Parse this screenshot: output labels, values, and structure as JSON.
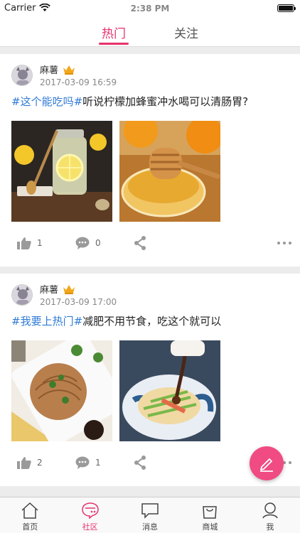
{
  "status_bar": {
    "carrier": "Carrier",
    "time": "2:38 PM"
  },
  "tabs": [
    {
      "label": "热门",
      "active": true
    },
    {
      "label": "关注",
      "active": false
    }
  ],
  "posts": [
    {
      "user": "麻薯",
      "time": "2017-03-09 16:59",
      "tag": "#这个能吃吗#",
      "text": "听说柠檬加蜂蜜冲水喝可以清肠胃?",
      "likes": "1",
      "comments": "0",
      "photos": [
        "lemon-honey-jar",
        "honey-dipper-bowl"
      ]
    },
    {
      "user": "麻薯",
      "time": "2017-03-09 17:00",
      "tag": "#我要上热门#",
      "text": "减肥不用节食，吃这个就可以",
      "likes": "2",
      "comments": "1",
      "photos": [
        "pasta-plate",
        "noodle-salad"
      ]
    }
  ],
  "bottom_nav": [
    {
      "label": "首页",
      "icon": "home-icon",
      "active": false
    },
    {
      "label": "社区",
      "icon": "community-icon",
      "active": true
    },
    {
      "label": "消息",
      "icon": "message-icon",
      "active": false
    },
    {
      "label": "商城",
      "icon": "shop-bag-icon",
      "active": false
    },
    {
      "label": "我",
      "icon": "profile-icon",
      "active": false
    }
  ],
  "colors": {
    "accent": "#e8326c",
    "tag": "#2f7bd6",
    "fab": "#f04b82"
  }
}
